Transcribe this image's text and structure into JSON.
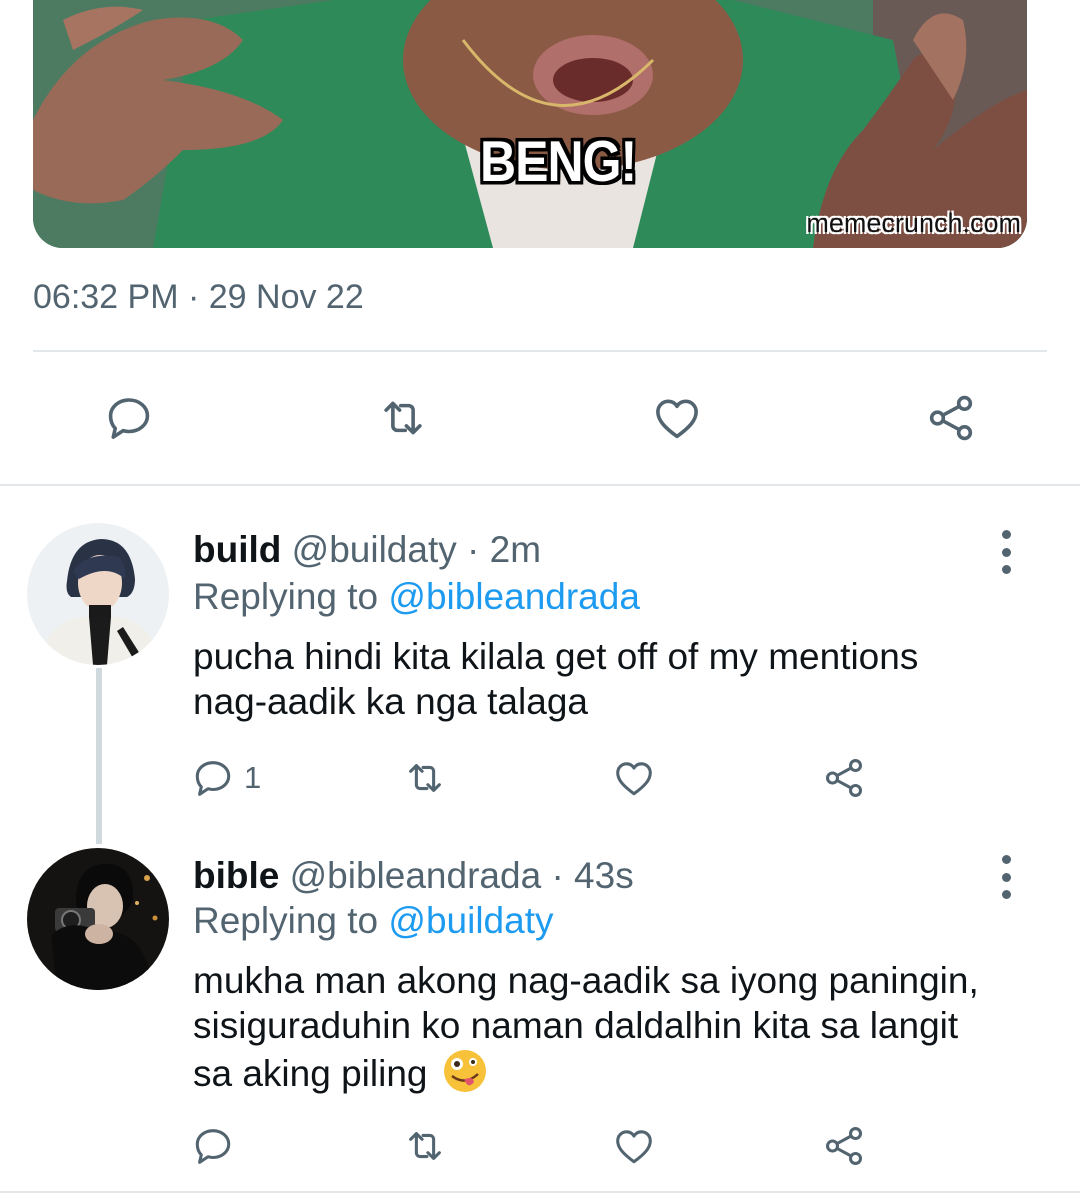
{
  "media": {
    "caption": "BENG!",
    "watermark": "memecrunch.com"
  },
  "tweet": {
    "timestamp": "06:32 PM · 29 Nov 22"
  },
  "actions_icons": [
    "reply-icon",
    "retweet-icon",
    "like-icon",
    "share-icon"
  ],
  "replies": [
    {
      "name": "build",
      "handle": "@buildaty",
      "separator": "·",
      "time": "2m",
      "replying_prefix": "Replying to ",
      "replying_to": "@bibleandrada",
      "text_line1": "pucha hindi kita kilala get off of my mentions",
      "text_line2": "nag-aadik ka nga talaga",
      "reply_count": "1"
    },
    {
      "name": "bible",
      "handle": "@bibleandrada",
      "separator": "·",
      "time": "43s",
      "replying_prefix": "Replying to ",
      "replying_to": "@buildaty",
      "text_line1": "mukha man akong nag-aadik sa iyong paningin,",
      "text_line2": "sisiguraduhin ko naman daldalhin kita sa langit",
      "text_line3": "sa aking piling",
      "emoji": "zany-face-emoji"
    }
  ],
  "colors": {
    "text": "#0f1419",
    "secondary": "#536471",
    "link": "#1d9bf0",
    "divider": "#e3e7ea"
  }
}
